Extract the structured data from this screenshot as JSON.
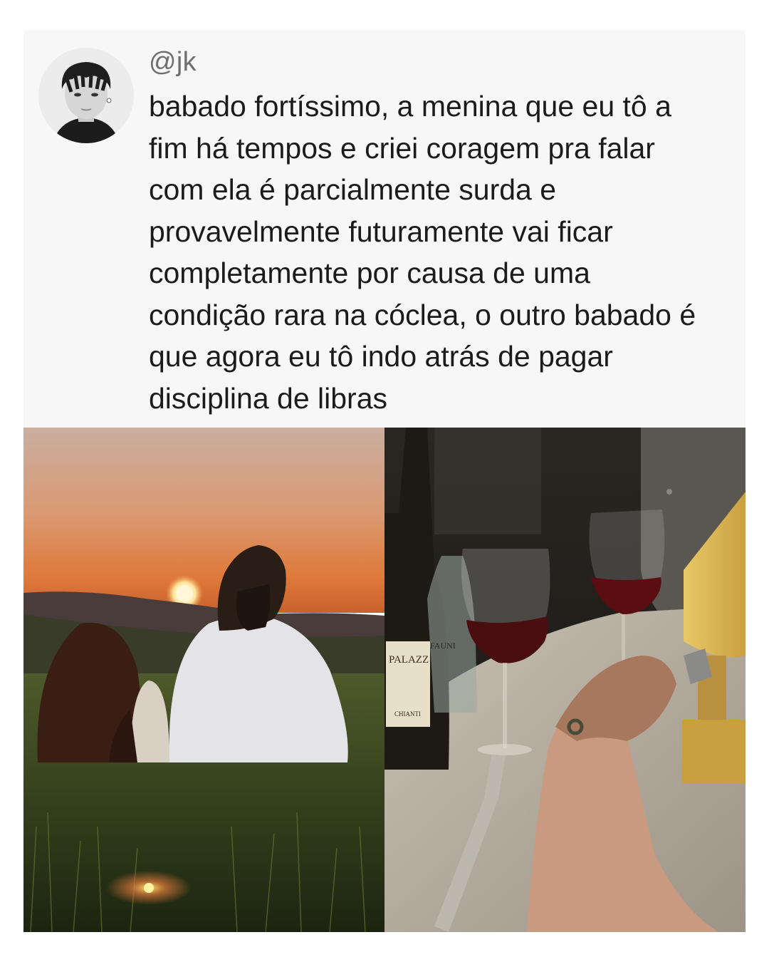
{
  "post": {
    "handle": "@jk",
    "lines": [
      "babado fortíssimo, a menina que eu tô a",
      "fim há tempos e criei coragem pra falar",
      "com ela é parcialmente surda e",
      "provavelmente futuramente vai ficar",
      "completamente por causa de uma",
      "condição rara na cóclea, o outro babado é",
      "que agora eu tô indo atrás de pagar",
      "disciplina de libras"
    ]
  },
  "photos": {
    "right": {
      "bottle_label_text": "PALAZZ",
      "bottle_label_sub": "CHIANTI",
      "water_label_text": "FAUNI"
    }
  },
  "colors": {
    "card_background": "#f7f7f7",
    "text": "#1b1b1b",
    "handle": "#6f6f6f"
  }
}
